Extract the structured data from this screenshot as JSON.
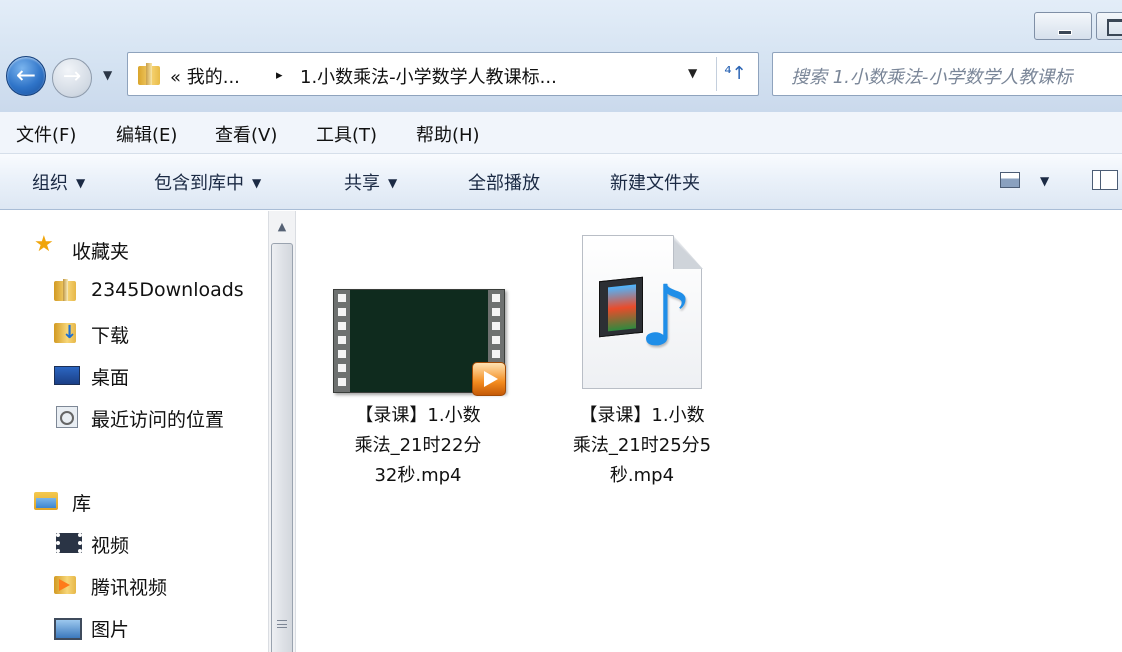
{
  "address": {
    "path_prefix": "« 我的...",
    "separator": "▸",
    "current_folder": "1.小数乘法-小学数学人教课标...",
    "dropdown_glyph": "▼",
    "refresh_glyph": "⁴↑"
  },
  "search": {
    "placeholder": "搜索 1.小数乘法-小学数学人教课标"
  },
  "nav_buttons": {
    "back_glyph": "←",
    "forward_glyph": "→",
    "history_glyph": "▼"
  },
  "menu": {
    "items": [
      "文件(F)",
      "编辑(E)",
      "查看(V)",
      "工具(T)",
      "帮助(H)"
    ]
  },
  "toolbar": {
    "organize": "组织",
    "include_in_library": "包含到库中",
    "share": "共享",
    "play_all": "全部播放",
    "new_folder": "新建文件夹",
    "dropdown_glyph": "▼"
  },
  "sidebar": {
    "favorites_header": "收藏夹",
    "favorites": [
      "2345Downloads",
      "下载",
      "桌面",
      "最近访问的位置"
    ],
    "libraries_header": "库",
    "libraries": [
      "视频",
      "腾讯视频",
      "图片"
    ]
  },
  "files": [
    {
      "name_lines": [
        "【录课】1.小数",
        "乘法_21时22分",
        "32秒.mp4"
      ],
      "icon": "video-thumbnail-icon"
    },
    {
      "name_lines": [
        "【录课】1.小数",
        "乘法_21时25分5",
        "秒.mp4"
      ],
      "icon": "media-file-icon"
    }
  ],
  "colors": {
    "chrome_blue": "#d5e3f2",
    "command_bar": "#e9f0f9",
    "accent_blue": "#2f74c8"
  }
}
